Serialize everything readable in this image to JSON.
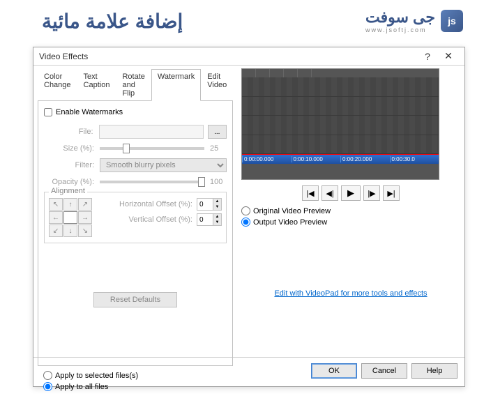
{
  "banner": {
    "arabic_text": "إضافة علامة مائية",
    "logo_text": "جى سوفت",
    "logo_url": "www.jsoftj.com",
    "logo_badge": "js"
  },
  "dialog": {
    "title": "Video Effects",
    "help_icon": "?",
    "close_icon": "✕"
  },
  "tabs": [
    "Color Change",
    "Text Caption",
    "Rotate and Flip",
    "Watermark",
    "Edit Video"
  ],
  "active_tab": 3,
  "watermark": {
    "enable_label": "Enable Watermarks",
    "file_label": "File:",
    "browse_label": "...",
    "size_label": "Size (%):",
    "size_value": "25",
    "filter_label": "Filter:",
    "filter_value": "Smooth blurry pixels",
    "opacity_label": "Opacity (%):",
    "opacity_value": "100",
    "alignment_label": "Alignment",
    "h_offset_label": "Horizontal Offset (%):",
    "h_offset_value": "0",
    "v_offset_label": "Vertical Offset (%):",
    "v_offset_value": "0",
    "reset_label": "Reset Defaults"
  },
  "apply": {
    "selected_label": "Apply to selected files(s)",
    "all_label": "Apply to all files"
  },
  "timeline": [
    "0:00:00.000",
    "0:00:10.000",
    "0:00:20.000",
    "0:00:30.0"
  ],
  "playback": {
    "first": "⏮",
    "prev": "◀",
    "play": "▶",
    "next": "▶",
    "last": "⏭"
  },
  "preview_radios": {
    "original": "Original Video Preview",
    "output": "Output Video Preview"
  },
  "preview_link": "Edit with VideoPad for more tools and effects",
  "footer": {
    "ok": "OK",
    "cancel": "Cancel",
    "help": "Help"
  }
}
